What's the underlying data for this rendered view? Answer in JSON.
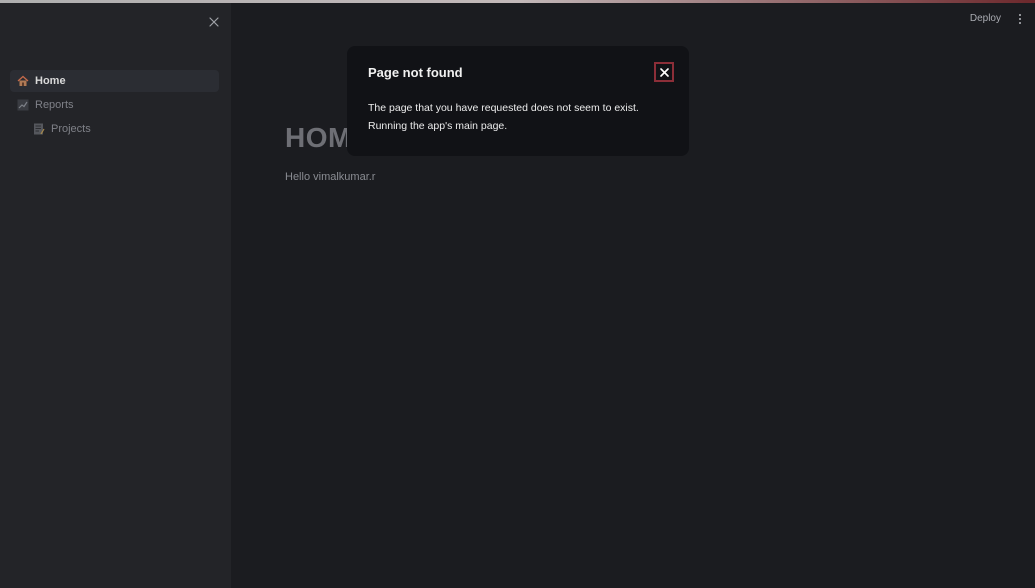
{
  "sidebar": {
    "items": [
      {
        "label": "Home",
        "icon": "house-icon",
        "active": true
      },
      {
        "label": "Reports",
        "icon": "chart-increasing-icon",
        "active": false
      },
      {
        "label": "Projects",
        "icon": "memo-icon",
        "active": false
      }
    ]
  },
  "header": {
    "deploy_label": "Deploy"
  },
  "main": {
    "heading": "HOM",
    "greeting": "Hello vimalkumar.r"
  },
  "modal": {
    "title": "Page not found",
    "body_line1": "The page that you have requested does not seem to exist.",
    "body_line2": "Running the app's main page."
  },
  "colors": {
    "background": "#1b1c20",
    "sidebar": "#232428",
    "modal": "#111216",
    "close_focus": "#8c2e38"
  }
}
